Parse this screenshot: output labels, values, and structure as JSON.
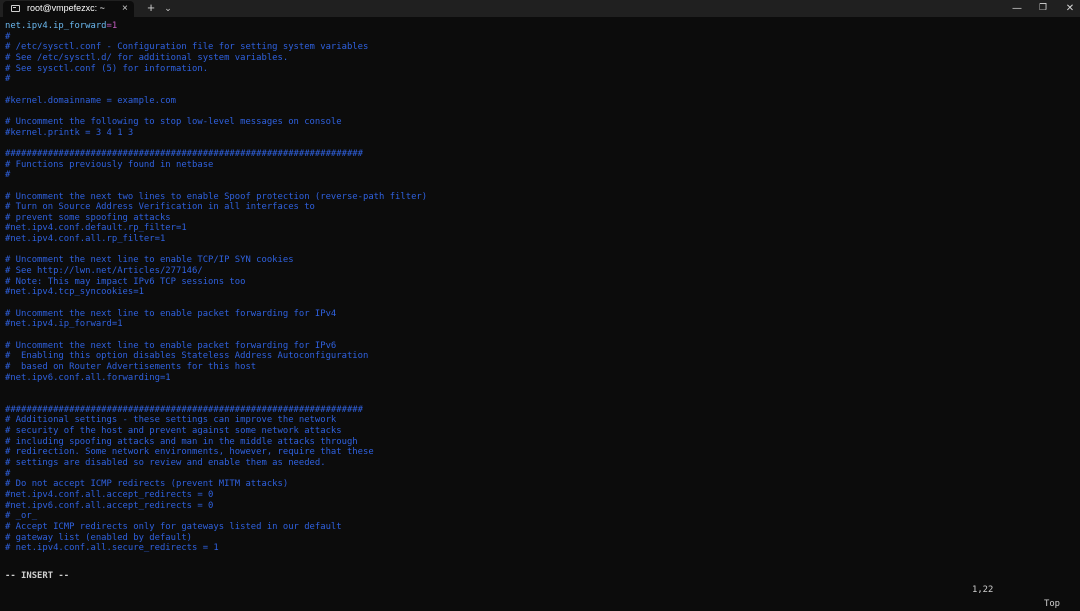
{
  "window": {
    "tab_title": "root@vmpefezxc: ~",
    "tab_close": "×",
    "new_tab": "+",
    "tab_menu": "⌄",
    "minimize": "—",
    "maximize": "❐",
    "close": "✕"
  },
  "first_line": {
    "key": "net.ipv4.ip_forward",
    "eq": "=",
    "value": "1"
  },
  "lines": [
    "#",
    "# /etc/sysctl.conf - Configuration file for setting system variables",
    "# See /etc/sysctl.d/ for additional system variables.",
    "# See sysctl.conf (5) for information.",
    "#",
    "",
    "#kernel.domainname = example.com",
    "",
    "# Uncomment the following to stop low-level messages on console",
    "#kernel.printk = 3 4 1 3",
    "",
    "###################################################################",
    "# Functions previously found in netbase",
    "#",
    "",
    "# Uncomment the next two lines to enable Spoof protection (reverse-path filter)",
    "# Turn on Source Address Verification in all interfaces to",
    "# prevent some spoofing attacks",
    "#net.ipv4.conf.default.rp_filter=1",
    "#net.ipv4.conf.all.rp_filter=1",
    "",
    "# Uncomment the next line to enable TCP/IP SYN cookies",
    "# See http://lwn.net/Articles/277146/",
    "# Note: This may impact IPv6 TCP sessions too",
    "#net.ipv4.tcp_syncookies=1",
    "",
    "# Uncomment the next line to enable packet forwarding for IPv4",
    "#net.ipv4.ip_forward=1",
    "",
    "# Uncomment the next line to enable packet forwarding for IPv6",
    "#  Enabling this option disables Stateless Address Autoconfiguration",
    "#  based on Router Advertisements for this host",
    "#net.ipv6.conf.all.forwarding=1",
    "",
    "",
    "###################################################################",
    "# Additional settings - these settings can improve the network",
    "# security of the host and prevent against some network attacks",
    "# including spoofing attacks and man in the middle attacks through",
    "# redirection. Some network environments, however, require that these",
    "# settings are disabled so review and enable them as needed.",
    "#",
    "# Do not accept ICMP redirects (prevent MITM attacks)",
    "#net.ipv4.conf.all.accept_redirects = 0",
    "#net.ipv6.conf.all.accept_redirects = 0",
    "# _or_",
    "# Accept ICMP redirects only for gateways listed in our default",
    "# gateway list (enabled by default)",
    "# net.ipv4.conf.all.secure_redirects = 1"
  ],
  "status": {
    "mode": "-- INSERT --",
    "position": "1,22",
    "scroll": "Top"
  },
  "colors": {
    "background": "#0c0c0c",
    "comment": "#2f61df",
    "identifier": "#6ab7ee",
    "constant": "#c25cc0",
    "status_text": "#d0d0d0"
  }
}
